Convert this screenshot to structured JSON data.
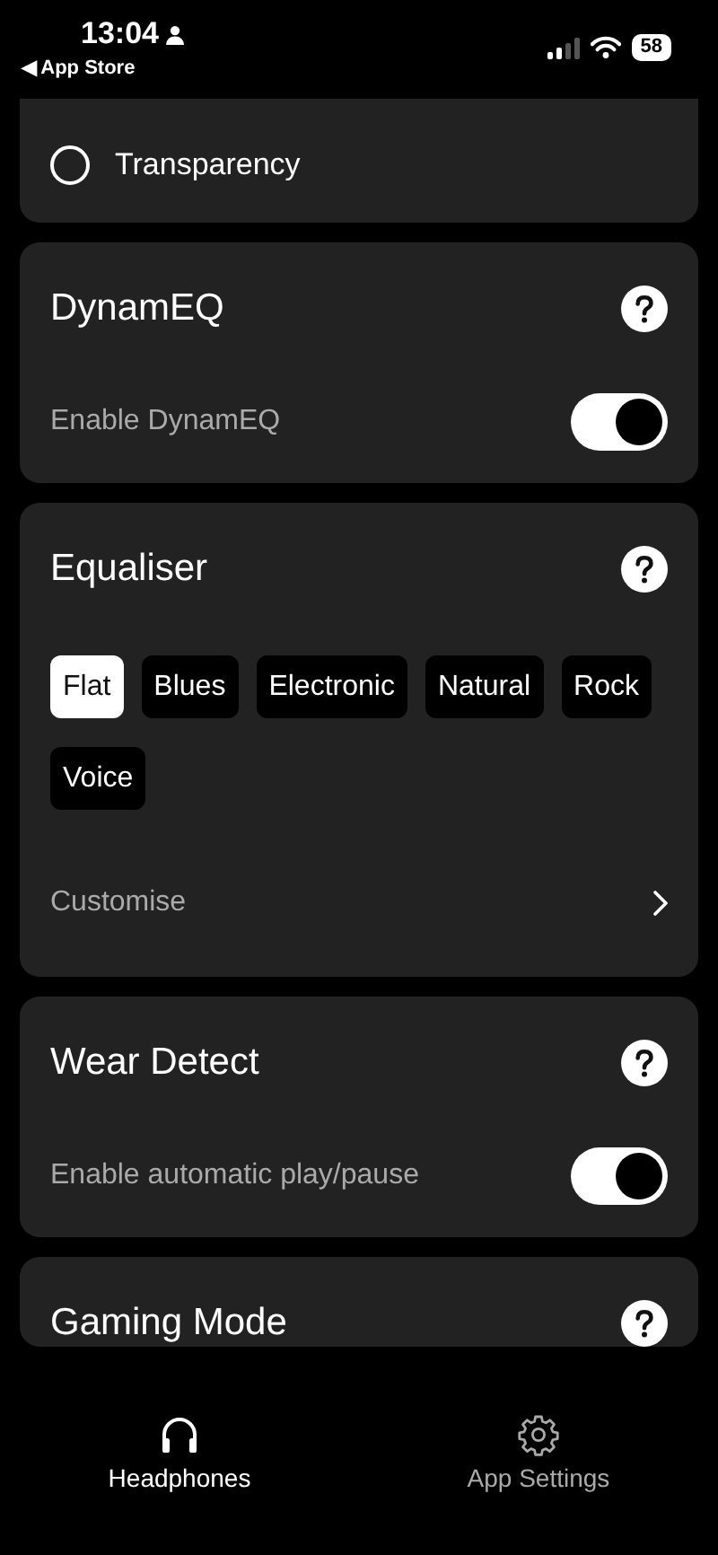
{
  "status_bar": {
    "time": "13:04",
    "back": "◀ App Store",
    "battery": "58"
  },
  "sections": [
    {
      "kind": "radio",
      "options": [
        {
          "label": "Transparency",
          "selected": false
        }
      ]
    },
    {
      "kind": "toggle",
      "title": "DynamEQ",
      "label": "Enable DynamEQ",
      "on": true
    },
    {
      "kind": "presets",
      "title": "Equaliser",
      "presets": [
        {
          "label": "Flat",
          "selected": true
        },
        {
          "label": "Blues",
          "selected": false
        },
        {
          "label": "Electronic",
          "selected": false
        },
        {
          "label": "Natural",
          "selected": false
        },
        {
          "label": "Rock",
          "selected": false
        },
        {
          "label": "Voice",
          "selected": false
        }
      ],
      "link": "Customise"
    },
    {
      "kind": "toggle",
      "title": "Wear Detect",
      "label": "Enable automatic play/pause",
      "on": true
    },
    {
      "kind": "header",
      "title": "Gaming Mode"
    }
  ],
  "tabs": [
    {
      "label": "Headphones",
      "selected": true
    },
    {
      "label": "App Settings",
      "selected": false
    }
  ]
}
